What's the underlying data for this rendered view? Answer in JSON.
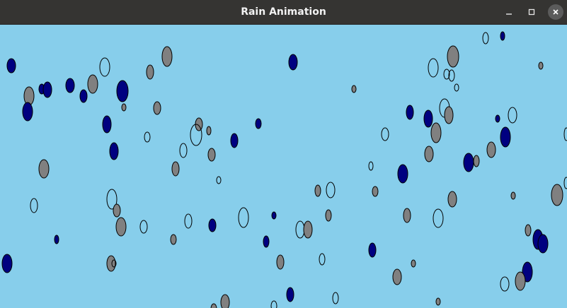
{
  "window": {
    "title": "Rain Animation"
  },
  "canvas": {
    "background": "#87ceeb"
  },
  "drop_styles": {
    "dark": {
      "fill": "#000080",
      "stroke": "#000000"
    },
    "gray": {
      "fill": "#808080",
      "stroke": "#000000"
    },
    "outline": {
      "fill": "none",
      "stroke": "#000000"
    }
  },
  "icons": {
    "minimize": "minimize-icon",
    "maximize": "maximize-icon",
    "close": "close-icon"
  }
}
